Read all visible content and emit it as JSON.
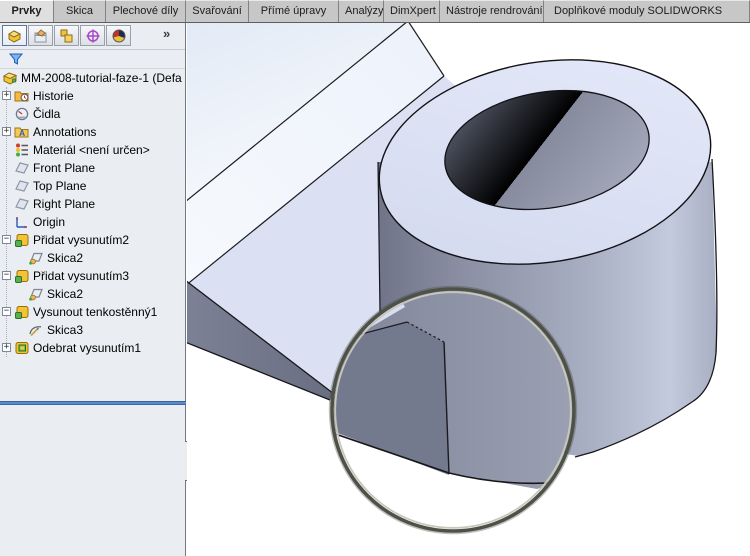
{
  "tabs": [
    {
      "label": "Prvky",
      "active": true
    },
    {
      "label": "Skica",
      "active": false
    },
    {
      "label": "Plechové díly",
      "active": false
    },
    {
      "label": "Svařování",
      "active": false
    },
    {
      "label": "Přímé úpravy",
      "active": false
    },
    {
      "label": "Analýzy",
      "active": false
    },
    {
      "label": "DimXpert",
      "active": false
    },
    {
      "label": "Nástroje rendrování",
      "active": false
    },
    {
      "label": "Doplňkové moduly SOLIDWORKS",
      "active": false
    }
  ],
  "panel": {
    "toolbar": {
      "buttons": [
        {
          "name": "featuremanager-design-tree",
          "active": true
        },
        {
          "name": "propertymanager",
          "active": false
        },
        {
          "name": "configurationmanager",
          "active": false
        },
        {
          "name": "dimxpertmanager",
          "active": false
        },
        {
          "name": "displaymanager",
          "active": false
        }
      ],
      "overflow_chevron": "»"
    },
    "tree": [
      {
        "label": "MM-2008-tutorial-faze-1 (Defa",
        "icon": "part",
        "expander_symbol": null
      },
      {
        "label": "Historie",
        "icon": "history-folder",
        "expander_symbol": "+"
      },
      {
        "label": "Čidla",
        "icon": "sensors",
        "expander_symbol": null
      },
      {
        "label": "Annotations",
        "icon": "annotations-folder",
        "expander_symbol": "+"
      },
      {
        "label": "Materiál <není určen>",
        "icon": "material",
        "expander_symbol": null
      },
      {
        "label": "Front Plane",
        "icon": "plane",
        "expander_symbol": null
      },
      {
        "label": "Top Plane",
        "icon": "plane",
        "expander_symbol": null
      },
      {
        "label": "Right Plane",
        "icon": "plane",
        "expander_symbol": null
      },
      {
        "label": "Origin",
        "icon": "origin",
        "expander_symbol": null
      },
      {
        "label": "Přidat vysunutím2",
        "icon": "boss-extrude",
        "expander_symbol": "−"
      },
      {
        "label": "Skica2",
        "icon": "sketch",
        "expander_symbol": null
      },
      {
        "label": "Přidat vysunutím3",
        "icon": "boss-extrude",
        "expander_symbol": "−"
      },
      {
        "label": "Skica2",
        "icon": "sketch",
        "expander_symbol": null
      },
      {
        "label": "Vysunout tenkostěnný1",
        "icon": "thin-extrude",
        "expander_symbol": "−"
      },
      {
        "label": "Skica3",
        "icon": "open-sketch",
        "expander_symbol": null
      },
      {
        "label": "Odebrat vysunutím1",
        "icon": "cut-extrude",
        "expander_symbol": "+"
      }
    ]
  },
  "colors": {
    "rollback_bar": "#3565B2",
    "magnifier_ring": "#4E5148",
    "part_top_face": "#D8DEF2",
    "part_side_face": "#959AAE",
    "part_front_face": "#7A7F93",
    "viewport_background": "#FFFFFF"
  }
}
